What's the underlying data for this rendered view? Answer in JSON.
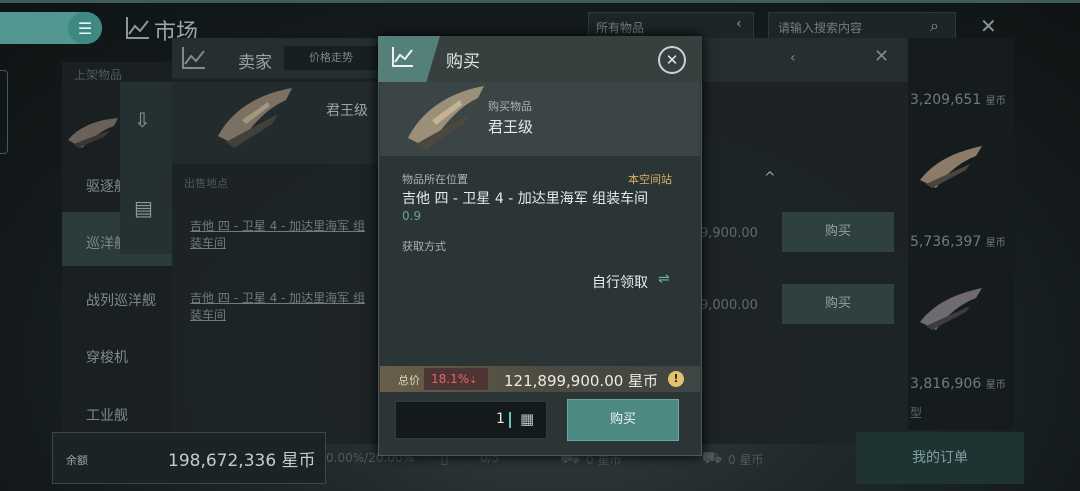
{
  "header": {
    "title": "市场",
    "filter_value": "所有物品",
    "search_placeholder": "请输入搜索内容"
  },
  "left_panel": {
    "header": "上架物品",
    "categories": [
      "驱逐舰",
      "巡洋舰",
      "战列巡洋舰",
      "穿梭机",
      "工业舰"
    ],
    "selected_category": "巡洋舰"
  },
  "seller_panel": {
    "title": "卖家",
    "trend_tab": "价格走势",
    "ship_name": "君王级",
    "location_header": "出售地点",
    "rows": [
      {
        "location": "吉他 四 - 卫星 4 - 加达里海军 组装车间"
      },
      {
        "location": "吉他 四 - 卫星 4 - 加达里海军 组装车间"
      }
    ]
  },
  "right_panel": {
    "prices": [
      "9,900.00",
      "9,000.00"
    ],
    "buy_label": "购买"
  },
  "far_right": {
    "prices": [
      "3,209,651",
      "5,736,397",
      "3,816,906"
    ],
    "unit": "星币",
    "type_label": "型",
    "my_orders": "我的订单"
  },
  "bottom_bar": {
    "balance_label": "余额",
    "balance_value": "198,672,336 星币",
    "pct": "0.00%/20.00%",
    "count": "0/5",
    "coin1": "0 星币",
    "coin2": "0 星币"
  },
  "dialog": {
    "title": "购买",
    "item_label": "购买物品",
    "item_name": "君王级",
    "location_label": "物品所在位置",
    "station_tag": "本空间站",
    "location_name": "吉他 四 - 卫星 4 - 加达里海军 组装车间",
    "security": "0.9",
    "acquire_label": "获取方式",
    "acquire_value": "自行领取",
    "total_label": "总价",
    "pct_change": "18.1%",
    "total_value": "121,899,900.00 星币",
    "quantity": "1",
    "buy_button": "购买"
  },
  "colors": {
    "accent": "#4d8882",
    "gold": "#d6b262",
    "warning_red": "#e06868"
  }
}
